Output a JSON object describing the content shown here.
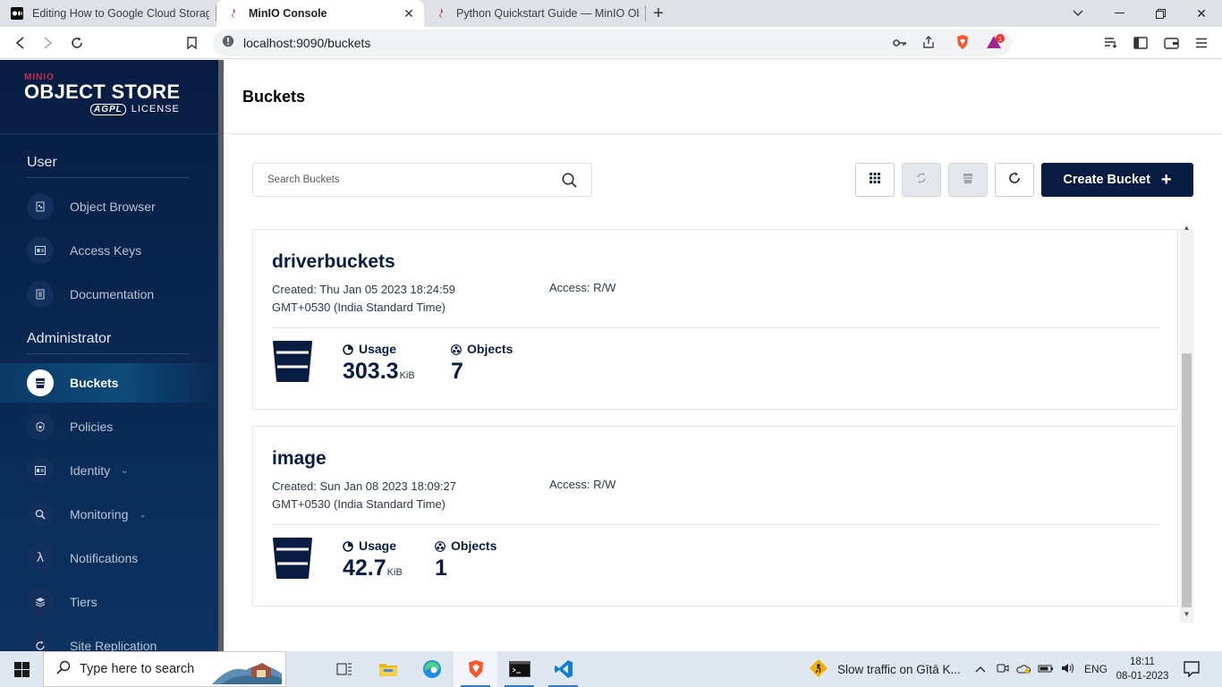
{
  "browser": {
    "tabs": [
      {
        "title": "Editing How to Google Cloud Storage",
        "active": false
      },
      {
        "title": "MinIO Console",
        "active": true
      },
      {
        "title": "Python Quickstart Guide — MinIO Ob",
        "active": false
      }
    ],
    "url": "localhost:9090/buckets",
    "brave_badge": "1"
  },
  "sidebar": {
    "brand": {
      "top": "MINIO",
      "title": "OBJECT STORE",
      "license_badge": "AGPL",
      "license_text": "LICENSE"
    },
    "sections": [
      {
        "header": "User",
        "items": [
          {
            "label": "Object Browser",
            "icon": "object-browser-icon"
          },
          {
            "label": "Access Keys",
            "icon": "access-keys-icon"
          },
          {
            "label": "Documentation",
            "icon": "documentation-icon"
          }
        ]
      },
      {
        "header": "Administrator",
        "items": [
          {
            "label": "Buckets",
            "icon": "bucket-icon",
            "active": true
          },
          {
            "label": "Policies",
            "icon": "policies-icon"
          },
          {
            "label": "Identity",
            "icon": "identity-icon",
            "expandable": true
          },
          {
            "label": "Monitoring",
            "icon": "monitoring-icon",
            "expandable": true
          },
          {
            "label": "Notifications",
            "icon": "lambda-icon"
          },
          {
            "label": "Tiers",
            "icon": "tiers-icon"
          },
          {
            "label": "Site Replication",
            "icon": "site-replication-icon"
          }
        ]
      }
    ]
  },
  "main": {
    "title": "Buckets",
    "search_placeholder": "Search Buckets",
    "create_button": "Create Bucket",
    "buckets": [
      {
        "name": "driverbuckets",
        "created": "Created: Thu Jan 05 2023 18:24:59 GMT+0530 (India Standard Time)",
        "access": "Access: R/W",
        "usage_label": "Usage",
        "usage_value": "303.3",
        "usage_unit": "KiB",
        "objects_label": "Objects",
        "objects_value": "7"
      },
      {
        "name": "image",
        "created": "Created: Sun Jan 08 2023 18:09:27 GMT+0530 (India Standard Time)",
        "access": "Access: R/W",
        "usage_label": "Usage",
        "usage_value": "42.7",
        "usage_unit": "KiB",
        "objects_label": "Objects",
        "objects_value": "1"
      }
    ]
  },
  "taskbar": {
    "search_placeholder": "Type here to search",
    "traffic": "Slow traffic on Gītā K...",
    "lang": "ENG",
    "time": "18:11",
    "date": "08-01-2023"
  },
  "colors": {
    "navy": "#081c42",
    "accent_red": "#c72e49"
  }
}
